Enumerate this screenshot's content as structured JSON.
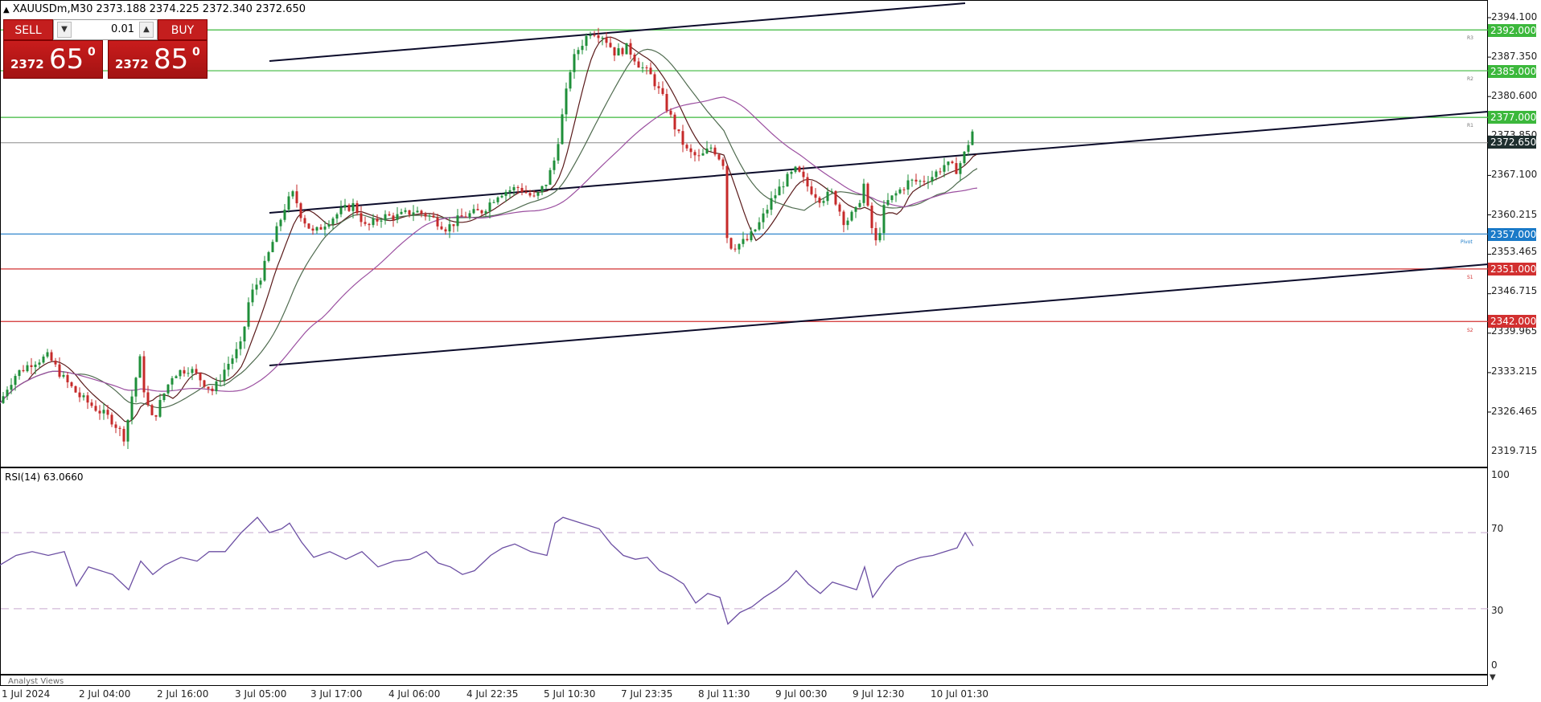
{
  "header": {
    "symbol_line": "XAUUSDm,M30  2373.188 2374.225 2372.340 2372.650"
  },
  "trade_panel": {
    "sell_label": "SELL",
    "buy_label": "BUY",
    "lot_value": "0.01",
    "bid": {
      "prefix": "2372",
      "big": "65",
      "sup": "0"
    },
    "ask": {
      "prefix": "2372",
      "big": "85",
      "sup": "0"
    }
  },
  "price_axis": {
    "ticks": [
      "2394.100",
      "2387.350",
      "2380.600",
      "2373.850",
      "2367.100",
      "2360.215",
      "2353.465",
      "2346.715",
      "2339.965",
      "2333.215",
      "2326.465",
      "2319.715"
    ],
    "current_price": "2372.650"
  },
  "levels": [
    {
      "price": "2392.000",
      "color": "#3cb83c",
      "tag": "R3"
    },
    {
      "price": "2385.000",
      "color": "#3cb83c",
      "tag": "R2"
    },
    {
      "price": "2377.000",
      "color": "#3cb83c",
      "tag": "R1"
    },
    {
      "price": "2357.000",
      "color": "#1a7ac8",
      "tag": "Pivot"
    },
    {
      "price": "2351.000",
      "color": "#d23030",
      "tag": "S1"
    },
    {
      "price": "2342.000",
      "color": "#d23030",
      "tag": "S2"
    }
  ],
  "rsi": {
    "label": "RSI(14) 63.0660",
    "ticks": [
      "100",
      "70",
      "30",
      "0"
    ]
  },
  "time_axis": {
    "labels": [
      "1 Jul 2024",
      "2 Jul 04:00",
      "2 Jul 16:00",
      "3 Jul 05:00",
      "3 Jul 17:00",
      "4 Jul 06:00",
      "4 Jul 22:35",
      "5 Jul 10:30",
      "7 Jul 23:35",
      "8 Jul 11:30",
      "9 Jul 00:30",
      "9 Jul 12:30",
      "10 Jul 01:30"
    ]
  },
  "bottom_bar": {
    "analyst_views": "Analyst Views"
  },
  "chart_data": {
    "type": "candlestick",
    "symbol": "XAUUSDm",
    "timeframe": "M30",
    "ylim": [
      2317,
      2396
    ],
    "close_path": [
      [
        0,
        2328
      ],
      [
        10,
        2331
      ],
      [
        20,
        2333
      ],
      [
        40,
        2335
      ],
      [
        60,
        2336
      ],
      [
        80,
        2332
      ],
      [
        100,
        2329
      ],
      [
        120,
        2327
      ],
      [
        140,
        2325
      ],
      [
        155,
        2322
      ],
      [
        165,
        2330
      ],
      [
        175,
        2336
      ],
      [
        180,
        2329
      ],
      [
        190,
        2325
      ],
      [
        205,
        2330
      ],
      [
        215,
        2333
      ],
      [
        235,
        2334
      ],
      [
        250,
        2332
      ],
      [
        265,
        2330
      ],
      [
        280,
        2334
      ],
      [
        300,
        2338
      ],
      [
        310,
        2346
      ],
      [
        325,
        2350
      ],
      [
        340,
        2356
      ],
      [
        355,
        2362
      ],
      [
        365,
        2364
      ],
      [
        375,
        2360
      ],
      [
        390,
        2357
      ],
      [
        405,
        2359
      ],
      [
        425,
        2361
      ],
      [
        440,
        2362
      ],
      [
        455,
        2358
      ],
      [
        475,
        2360
      ],
      [
        495,
        2360
      ],
      [
        515,
        2361
      ],
      [
        535,
        2360
      ],
      [
        555,
        2358
      ],
      [
        575,
        2360
      ],
      [
        600,
        2361
      ],
      [
        620,
        2364
      ],
      [
        645,
        2365
      ],
      [
        665,
        2363
      ],
      [
        680,
        2366
      ],
      [
        690,
        2370
      ],
      [
        700,
        2378
      ],
      [
        710,
        2386
      ],
      [
        720,
        2389
      ],
      [
        735,
        2392
      ],
      [
        750,
        2391
      ],
      [
        765,
        2388
      ],
      [
        780,
        2389
      ],
      [
        795,
        2386
      ],
      [
        810,
        2384
      ],
      [
        825,
        2380
      ],
      [
        840,
        2375
      ],
      [
        855,
        2371
      ],
      [
        870,
        2370
      ],
      [
        885,
        2372
      ],
      [
        900,
        2369
      ],
      [
        898,
        2366
      ],
      [
        905,
        2355
      ],
      [
        915,
        2355
      ],
      [
        930,
        2356
      ],
      [
        945,
        2359
      ],
      [
        960,
        2363
      ],
      [
        975,
        2366
      ],
      [
        990,
        2368
      ],
      [
        1005,
        2365
      ],
      [
        1020,
        2363
      ],
      [
        1035,
        2364
      ],
      [
        1050,
        2359
      ],
      [
        1065,
        2361
      ],
      [
        1075,
        2366
      ],
      [
        1080,
        2360
      ],
      [
        1090,
        2355
      ],
      [
        1100,
        2362
      ],
      [
        1115,
        2364
      ],
      [
        1130,
        2366
      ],
      [
        1145,
        2366
      ],
      [
        1160,
        2367
      ],
      [
        1175,
        2369
      ],
      [
        1190,
        2368
      ],
      [
        1200,
        2371
      ],
      [
        1210,
        2375
      ],
      [
        1215,
        2372
      ]
    ],
    "rsi_path": [
      [
        0,
        53
      ],
      [
        20,
        58
      ],
      [
        40,
        60
      ],
      [
        60,
        58
      ],
      [
        80,
        60
      ],
      [
        95,
        42
      ],
      [
        110,
        52
      ],
      [
        125,
        50
      ],
      [
        140,
        48
      ],
      [
        160,
        40
      ],
      [
        175,
        55
      ],
      [
        190,
        48
      ],
      [
        205,
        53
      ],
      [
        225,
        57
      ],
      [
        245,
        55
      ],
      [
        260,
        60
      ],
      [
        280,
        60
      ],
      [
        300,
        70
      ],
      [
        320,
        78
      ],
      [
        335,
        70
      ],
      [
        350,
        72
      ],
      [
        360,
        75
      ],
      [
        375,
        65
      ],
      [
        390,
        57
      ],
      [
        410,
        60
      ],
      [
        430,
        56
      ],
      [
        450,
        60
      ],
      [
        470,
        52
      ],
      [
        490,
        55
      ],
      [
        510,
        56
      ],
      [
        530,
        60
      ],
      [
        545,
        54
      ],
      [
        560,
        52
      ],
      [
        575,
        48
      ],
      [
        590,
        50
      ],
      [
        610,
        58
      ],
      [
        625,
        62
      ],
      [
        640,
        64
      ],
      [
        660,
        60
      ],
      [
        680,
        58
      ],
      [
        690,
        75
      ],
      [
        700,
        78
      ],
      [
        715,
        76
      ],
      [
        730,
        74
      ],
      [
        745,
        72
      ],
      [
        760,
        64
      ],
      [
        775,
        58
      ],
      [
        790,
        56
      ],
      [
        805,
        57
      ],
      [
        820,
        50
      ],
      [
        835,
        47
      ],
      [
        850,
        43
      ],
      [
        865,
        33
      ],
      [
        880,
        38
      ],
      [
        895,
        36
      ],
      [
        905,
        22
      ],
      [
        920,
        28
      ],
      [
        935,
        31
      ],
      [
        950,
        36
      ],
      [
        965,
        40
      ],
      [
        980,
        45
      ],
      [
        990,
        50
      ],
      [
        1005,
        43
      ],
      [
        1020,
        38
      ],
      [
        1035,
        44
      ],
      [
        1050,
        42
      ],
      [
        1065,
        40
      ],
      [
        1075,
        52
      ],
      [
        1085,
        36
      ],
      [
        1100,
        45
      ],
      [
        1115,
        52
      ],
      [
        1130,
        55
      ],
      [
        1145,
        57
      ],
      [
        1160,
        58
      ],
      [
        1175,
        60
      ],
      [
        1190,
        62
      ],
      [
        1200,
        70
      ],
      [
        1210,
        63
      ]
    ]
  }
}
